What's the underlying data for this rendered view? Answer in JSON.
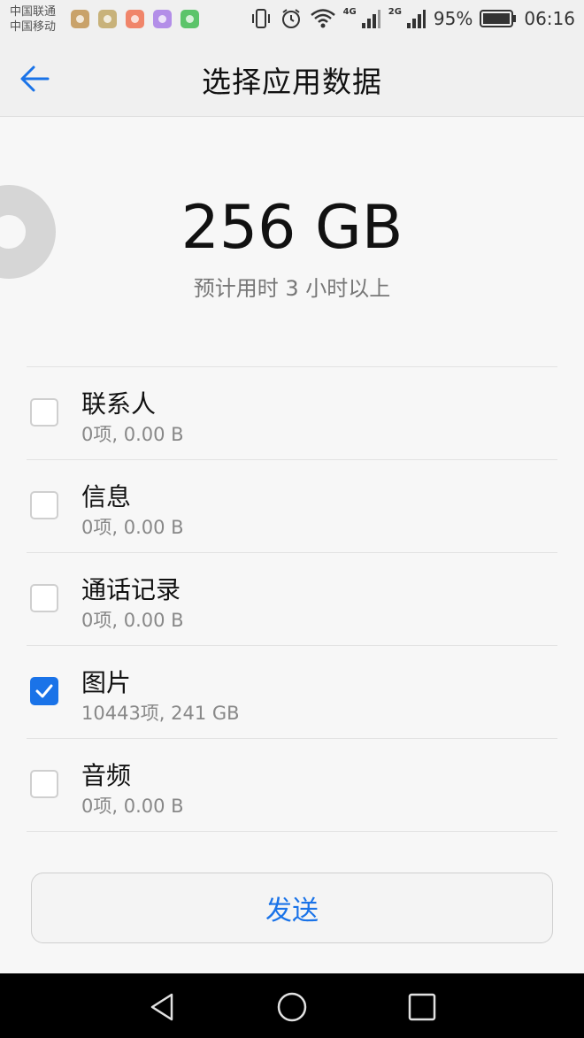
{
  "status_bar": {
    "carrier_1": "中国联通",
    "carrier_2": "中国移动",
    "notification_icons": [
      {
        "name": "app-notif-icon-1",
        "color": "#c9a26a"
      },
      {
        "name": "app-notif-icon-2",
        "color": "#c8b27a"
      },
      {
        "name": "app-notif-icon-3",
        "color": "#f0856a"
      },
      {
        "name": "app-notif-icon-4",
        "color": "#b38ee8"
      },
      {
        "name": "battery-app-icon",
        "color": "#5cc46a"
      }
    ],
    "net_4g": "4G",
    "net_2g": "2G",
    "battery_percent": "95%",
    "time": "06:16"
  },
  "appbar": {
    "title": "选择应用数据"
  },
  "summary": {
    "total_size": "256 GB",
    "estimate": "预计用时 3 小时以上"
  },
  "items": [
    {
      "title": "联系人",
      "subtitle": "0项, 0.00 B",
      "checked": false
    },
    {
      "title": "信息",
      "subtitle": "0项, 0.00 B",
      "checked": false
    },
    {
      "title": "通话记录",
      "subtitle": "0项, 0.00 B",
      "checked": false
    },
    {
      "title": "图片",
      "subtitle": "10443项, 241 GB",
      "checked": true
    },
    {
      "title": "音频",
      "subtitle": "0项, 0.00 B",
      "checked": false
    }
  ],
  "send_button": {
    "label": "发送"
  },
  "colors": {
    "accent": "#1a73e8"
  }
}
